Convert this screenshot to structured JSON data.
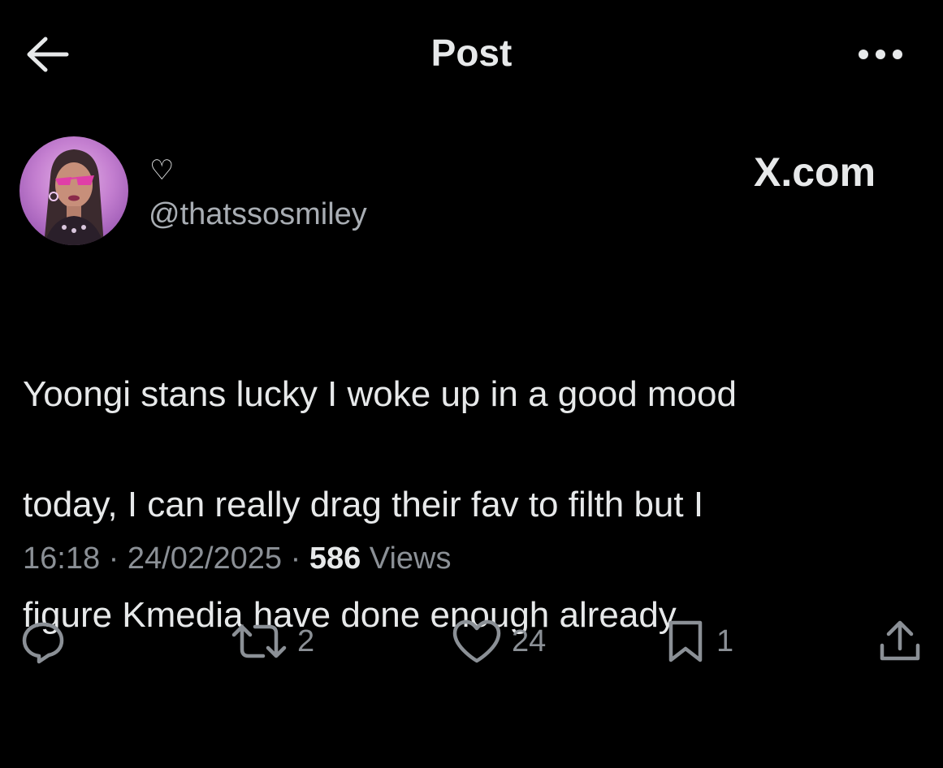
{
  "header": {
    "title": "Post",
    "back_icon": "arrow-left-icon",
    "more_icon": "more-dots-icon"
  },
  "author": {
    "display_name": "♡",
    "handle": "@thatssosmiley",
    "avatar_icon": "avatar-pink-doll"
  },
  "watermark": "X.com",
  "post": {
    "lines": [
      "Yoongi stans lucky I woke up in a good mood",
      "today, I can really drag their fav to filth but I",
      "figure Kmedia have done enough already"
    ]
  },
  "meta": {
    "time": "16:18",
    "sep1": " · ",
    "date": "24/02/2025",
    "sep2": " · ",
    "views_count": "586",
    "views_label": " Views"
  },
  "actions": {
    "reply": {
      "icon": "reply-icon",
      "count": ""
    },
    "repost": {
      "icon": "repost-icon",
      "count": "2"
    },
    "like": {
      "icon": "heart-icon",
      "count": "24"
    },
    "bookmark": {
      "icon": "bookmark-icon",
      "count": "1"
    },
    "share": {
      "icon": "share-icon",
      "count": ""
    }
  },
  "colors": {
    "background": "#000000",
    "text": "#e7e9ea",
    "muted": "#8b9096"
  }
}
